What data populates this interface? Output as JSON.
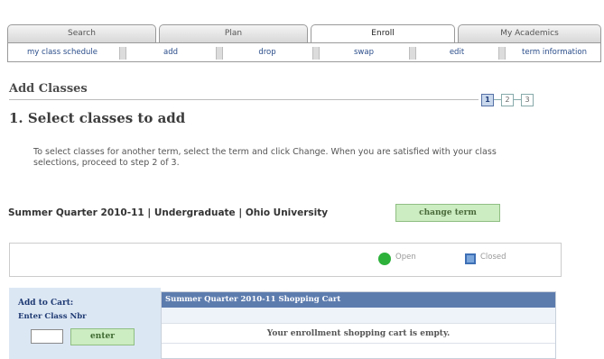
{
  "tabs": [
    {
      "label": "Search"
    },
    {
      "label": "Plan"
    },
    {
      "label": "Enroll"
    },
    {
      "label": "My Academics"
    }
  ],
  "subtabs": [
    {
      "label": "my class schedule"
    },
    {
      "label": "add"
    },
    {
      "label": "drop"
    },
    {
      "label": "swap"
    },
    {
      "label": "edit"
    },
    {
      "label": "term information"
    }
  ],
  "page": {
    "title": "Add Classes",
    "step_heading": "1.  Select classes to add",
    "steps": [
      "1",
      "2",
      "3"
    ],
    "instructions": "To select classes for another term, select the term and click Change.  When you are satisfied with your class selections, proceed to step 2 of 3.",
    "term_line": "Summer Quarter 2010-11 | Undergraduate | Ohio University",
    "change_term_label": "change term"
  },
  "legend": {
    "open_label": "Open",
    "closed_label": "Closed",
    "open_color": "#2db13b",
    "closed_color": "#7aa6dc"
  },
  "cart": {
    "title": "Add to Cart:",
    "enter_label": "Enter Class Nbr",
    "input_value": "",
    "enter_button": "enter"
  },
  "shopping_cart": {
    "header": "Summer Quarter 2010-11 Shopping Cart",
    "empty_message": "Your enrollment shopping cart is empty."
  }
}
